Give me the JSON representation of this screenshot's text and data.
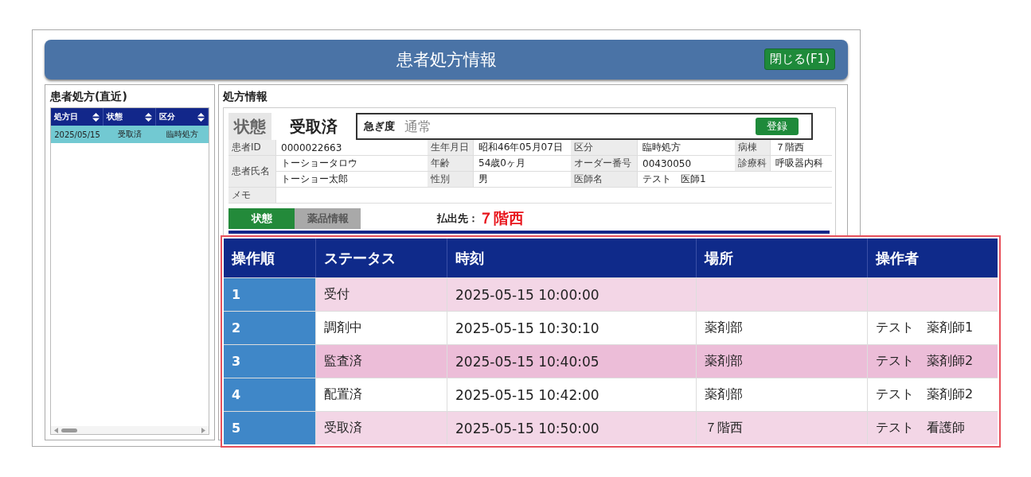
{
  "window": {
    "title": "患者処方情報",
    "close_button": "閉じる(F1)"
  },
  "recent": {
    "title": "患者処方(直近)",
    "columns": [
      "処方日",
      "状態",
      "区分"
    ],
    "rows": [
      {
        "cells": [
          "2025/05/15",
          "受取済",
          "臨時処方"
        ],
        "selected": true
      }
    ]
  },
  "info": {
    "title": "処方情報",
    "status_label": "状態",
    "status_value": "受取済",
    "urgency_label": "急ぎ度",
    "urgency_value": "通常",
    "register_button": "登録",
    "grid": [
      [
        {
          "label": "患者ID",
          "value": "0000022663"
        },
        {
          "label": "生年月日",
          "value": "昭和46年05月07日"
        },
        {
          "label": "区分",
          "value": "臨時処方"
        },
        {
          "label": "病棟",
          "value": "７階西"
        }
      ],
      [
        {
          "label": "患者氏名",
          "value": "トーショータロウ"
        },
        {
          "label": "年齢",
          "value": "54歳0ヶ月"
        },
        {
          "label": "オーダー番号",
          "value": "00430050"
        },
        {
          "label": "診療科",
          "value": "呼吸器内科"
        }
      ],
      [
        {
          "value": "トーショー太郎"
        },
        {
          "label": "性別",
          "value": "男"
        },
        {
          "label": "医師名",
          "value": "テスト　医師1"
        }
      ]
    ],
    "memo_label": "メモ",
    "tabs": [
      {
        "label": "状態",
        "selected": true
      },
      {
        "label": "薬品情報",
        "selected": false
      }
    ],
    "destination_label": "払出先：",
    "destination_value": "７階西"
  },
  "history": {
    "columns": [
      "操作順",
      "ステータス",
      "時刻",
      "場所",
      "操作者"
    ],
    "rows": [
      {
        "cells": [
          "1",
          "受付",
          "2025-05-15 10:00:00",
          "",
          ""
        ],
        "selected": false
      },
      {
        "cells": [
          "2",
          "調剤中",
          "2025-05-15 10:30:10",
          "薬剤部",
          "テスト　薬剤師1"
        ],
        "selected": false
      },
      {
        "cells": [
          "3",
          "監査済",
          "2025-05-15 10:40:05",
          "薬剤部",
          "テスト　薬剤師2"
        ],
        "selected": true
      },
      {
        "cells": [
          "4",
          "配置済",
          "2025-05-15 10:42:00",
          "薬剤部",
          "テスト　薬剤師2"
        ],
        "selected": false
      },
      {
        "cells": [
          "5",
          "受取済",
          "2025-05-15 10:50:00",
          "７階西",
          "テスト　看護師"
        ],
        "selected": false
      }
    ]
  }
}
